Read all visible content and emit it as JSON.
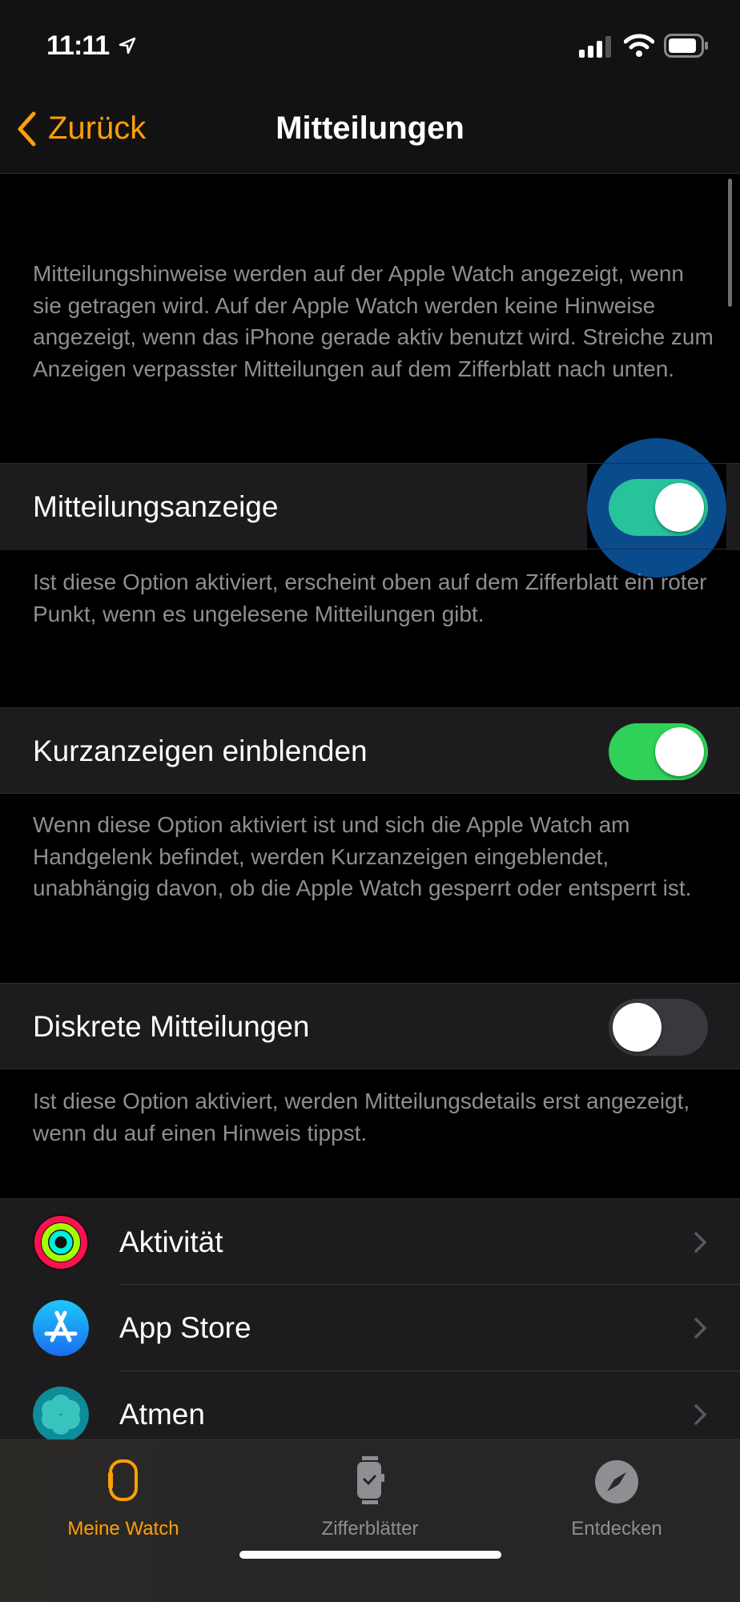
{
  "status_bar": {
    "time": "11:11",
    "icons": [
      "location-arrow-icon",
      "cellular-signal-icon",
      "wifi-icon",
      "battery-icon"
    ]
  },
  "nav": {
    "back_label": "Zurück",
    "title": "Mitteilungen"
  },
  "intro_text": "Mitteilungshinweise werden auf der Apple Watch angezeigt, wenn sie getragen wird. Auf der Apple Watch werden keine Hinweise angezeigt, wenn das iPhone gerade aktiv benutzt wird. Streiche zum Anzeigen verpasster Mitteilungen auf dem Zifferblatt nach unten.",
  "settings": [
    {
      "label": "Mitteilungsanzeige",
      "on": true,
      "footer": "Ist diese Option aktiviert, erscheint oben auf dem Zifferblatt ein roter Punkt, wenn es ungelesene Mitteilungen gibt."
    },
    {
      "label": "Kurzanzeigen einblenden",
      "on": true,
      "footer": "Wenn diese Option aktiviert ist und sich die Apple Watch am Handgelenk befindet, werden Kurzanzeigen eingeblendet, unabhängig davon, ob die Apple Watch gesperrt oder entsperrt ist."
    },
    {
      "label": "Diskrete Mitteilungen",
      "on": false,
      "footer": "Ist diese Option aktiviert, werden Mitteilungsdetails erst angezeigt, wenn du auf einen Hinweis tippst."
    }
  ],
  "apps": [
    {
      "label": "Aktivität",
      "icon": "activity-rings-icon"
    },
    {
      "label": "App Store",
      "icon": "app-store-icon"
    },
    {
      "label": "Atmen",
      "icon": "breathe-icon"
    }
  ],
  "tabs": [
    {
      "label": "Meine Watch",
      "icon": "watch-icon",
      "active": true
    },
    {
      "label": "Zifferblätter",
      "icon": "watch-face-icon",
      "active": false
    },
    {
      "label": "Entdecken",
      "icon": "compass-icon",
      "active": false
    }
  ],
  "colors": {
    "accent": "#ff9f0a",
    "toggle_on": "#30d158",
    "highlight": "#0a4b8c",
    "secondary_text": "#8e8e93"
  }
}
